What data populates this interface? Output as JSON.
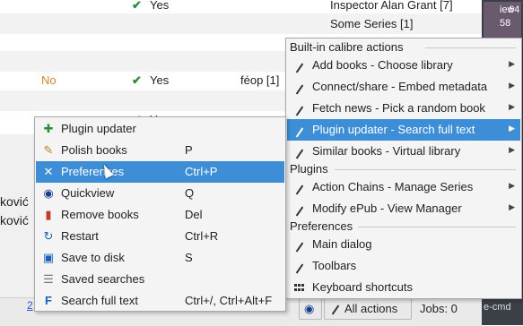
{
  "table": {
    "rows": [
      {
        "ident": "",
        "yes": "Yes",
        "format": "",
        "series": "Inspector Alan Grant [7]"
      },
      {
        "ident": "",
        "yes": "",
        "format": "",
        "series": "Some Series [1]"
      },
      {
        "ident": "No",
        "yes": "Yes",
        "format": "féop [1]",
        "series": ""
      },
      {
        "ident": "",
        "yes": "Yes",
        "format": "",
        "series": ""
      }
    ],
    "fragments": [
      "ković",
      "ković"
    ],
    "right_thumb_text_1": "iew",
    "right_thumb_text_2": "64",
    "right_thumb_text_3": "58",
    "right_bottom_text": "e-cmd"
  },
  "left_menu": {
    "items": [
      {
        "label": "Plugin updater",
        "shortcut": "",
        "icon": "puzzle-icon"
      },
      {
        "label": "Polish books",
        "shortcut": "P",
        "icon": "brush-icon"
      },
      {
        "label": "Preferences",
        "shortcut": "Ctrl+P",
        "icon": "tools-icon",
        "selected": true
      },
      {
        "label": "Quickview",
        "shortcut": "Q",
        "icon": "eye-icon"
      },
      {
        "label": "Remove books",
        "shortcut": "Del",
        "icon": "trash-icon"
      },
      {
        "label": "Restart",
        "shortcut": "Ctrl+R",
        "icon": "restart-icon"
      },
      {
        "label": "Save to disk",
        "shortcut": "S",
        "icon": "save-icon"
      },
      {
        "label": "Saved searches",
        "shortcut": "",
        "icon": "saved-search-icon"
      },
      {
        "label": "Search full text",
        "shortcut": "Ctrl+/, Ctrl+Alt+F",
        "icon": "fulltext-icon"
      }
    ]
  },
  "right_menu": {
    "section_builtin": "Built-in calibre actions",
    "builtin_items": [
      {
        "label": "Add books - Choose library"
      },
      {
        "label": "Connect/share - Embed metadata"
      },
      {
        "label": "Fetch news - Pick a random book"
      },
      {
        "label": "Plugin updater - Search full text",
        "selected": true
      },
      {
        "label": "Similar books - Virtual library"
      }
    ],
    "section_plugins": "Plugins",
    "plugin_items": [
      {
        "label": "Action Chains - Manage Series"
      },
      {
        "label": "Modify ePub - View Manager"
      }
    ],
    "section_preferences": "Preferences",
    "pref_items": [
      {
        "label": "Main dialog"
      },
      {
        "label": "Toolbars"
      },
      {
        "label": "Keyboard shortcuts"
      }
    ]
  },
  "statusbar": {
    "left_link": "2",
    "all_actions": "All actions",
    "jobs": "Jobs: 0"
  },
  "colors": {
    "selection": "#3d8ed6",
    "check": "#2e8b3e"
  }
}
